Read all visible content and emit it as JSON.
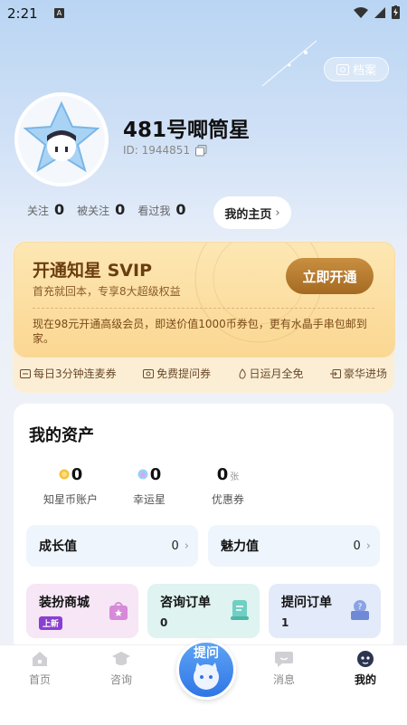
{
  "status_bar": {
    "time": "2:21",
    "notif_icon": "A"
  },
  "header": {
    "archive_label": "档案"
  },
  "profile": {
    "username": "481号唧筒星",
    "user_id": "ID: 1944851"
  },
  "stats": [
    {
      "label": "关注",
      "value": "0"
    },
    {
      "label": "被关注",
      "value": "0"
    },
    {
      "label": "看过我",
      "value": "0"
    }
  ],
  "home_button": "我的主页",
  "vip": {
    "title": "开通知星 SVIP",
    "subtitle": "首充就回本，专享8大超级权益",
    "button": "立即开通",
    "description": "现在98元开通高级会员，即送价值1000币券包，更有水晶手串包邮到家。",
    "perks": [
      "每日3分钟连麦券",
      "免费提问券",
      "日运月全免",
      "豪华进场"
    ]
  },
  "assets": {
    "title": "我的资产",
    "items": [
      {
        "value": "0",
        "label": "知星币账户",
        "icon": "coin-icon",
        "unit": ""
      },
      {
        "value": "0",
        "label": "幸运星",
        "icon": "lucky-star-icon",
        "unit": ""
      },
      {
        "value": "0",
        "label": "优惠券",
        "icon": "",
        "unit": "张"
      }
    ],
    "tiles": [
      {
        "label": "成长值",
        "value": "0"
      },
      {
        "label": "魅力值",
        "value": "0"
      }
    ],
    "cards": [
      {
        "title": "装扮商城",
        "sub": "上新",
        "color": "#f7e8f7"
      },
      {
        "title": "咨询订单",
        "sub": "0",
        "color": "#e2f4f2"
      },
      {
        "title": "提问订单",
        "sub": "1",
        "color": "#e6ecfa"
      }
    ]
  },
  "nav": {
    "items": [
      "首页",
      "咨询",
      "消息",
      "我的"
    ],
    "ask": "提问"
  },
  "colors": {
    "accent": "#2f76e6",
    "vip_gold": "#a56a22"
  }
}
